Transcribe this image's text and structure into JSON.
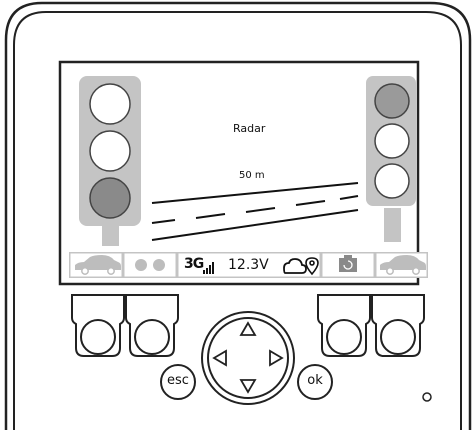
{
  "screen": {
    "title": "Radar",
    "distance": "50 m"
  },
  "status_bar": {
    "network": "3G",
    "voltage": "12.3V",
    "icons": [
      "car-icon",
      "dual-dot-icon",
      "signal-bars-icon",
      "cloud-icon",
      "location-pin-icon",
      "camera-rotate-icon",
      "car-icon"
    ]
  },
  "lights": {
    "left": [
      "off",
      "off",
      "on"
    ],
    "right": [
      "on",
      "off",
      "off"
    ]
  },
  "keys": {
    "esc": "esc",
    "ok": "ok"
  },
  "colors": {
    "bezel": "#222222",
    "lcd_background": "#ffffff",
    "light_housing": "#c4c4c4",
    "lamp_off": "#ffffff",
    "lamp_on": "#8a8a8a",
    "status_bar": "#c4c4c4"
  }
}
